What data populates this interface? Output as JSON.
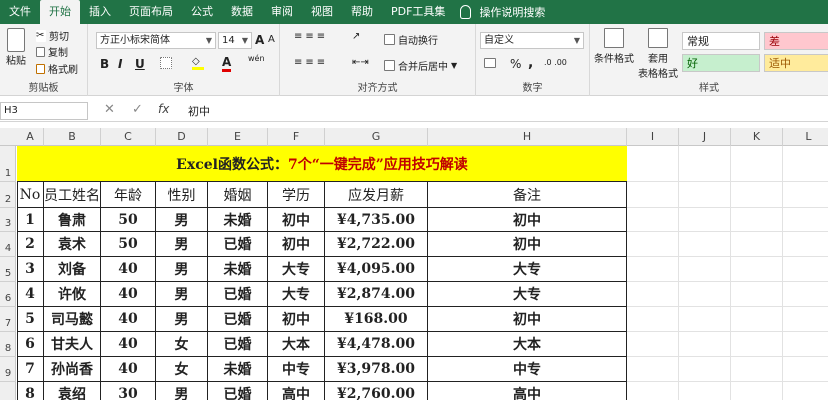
{
  "ribbon_tabs": [
    "文件",
    "开始",
    "插入",
    "页面布局",
    "公式",
    "数据",
    "审阅",
    "视图",
    "帮助",
    "PDF工具集",
    "操作说明搜索"
  ],
  "clipboard": {
    "paste": "粘贴",
    "cut": "剪切",
    "copy": "复制",
    "painter": "格式刷",
    "label": "剪贴板"
  },
  "font": {
    "name": "方正小标宋简体",
    "size": "14",
    "label": "字体",
    "bold": "B",
    "italic": "I",
    "underline": "U",
    "grow": "A",
    "shrink": "A",
    "wen": "wén"
  },
  "alignment": {
    "wrap": "自动换行",
    "merge": "合并后居中",
    "label": "对齐方式"
  },
  "number": {
    "format": "自定义",
    "pct": "%",
    "comma": ",",
    "label": "数字"
  },
  "styles": {
    "cond": "条件格式",
    "table": "套用\n表格格式",
    "normal": "常规",
    "bad": "差",
    "good": "好",
    "neutral": "适中",
    "label": "样式"
  },
  "formula_bar": {
    "name_box": "H3",
    "cancel": "✕",
    "enter": "✓",
    "fx": "fx",
    "content": "初中"
  },
  "columns": [
    "A",
    "B",
    "C",
    "D",
    "E",
    "F",
    "G",
    "H",
    "I",
    "J",
    "K",
    "L"
  ],
  "rows": [
    "1",
    "2",
    "3",
    "4",
    "5",
    "6",
    "7",
    "8",
    "9"
  ],
  "title": {
    "prefix": "Excel函数公式：",
    "suffix": "7个“一键完成”应用技巧解读"
  },
  "headers": [
    "No",
    "员工姓名",
    "年龄",
    "性别",
    "婚姻",
    "学历",
    "应发月薪",
    "备注"
  ],
  "table_rows": [
    [
      "1",
      "鲁肃",
      "50",
      "男",
      "未婚",
      "初中",
      "¥4,735.00",
      "初中"
    ],
    [
      "2",
      "袁术",
      "50",
      "男",
      "已婚",
      "初中",
      "¥2,722.00",
      "初中"
    ],
    [
      "3",
      "刘备",
      "40",
      "男",
      "未婚",
      "大专",
      "¥4,095.00",
      "大专"
    ],
    [
      "4",
      "许攸",
      "40",
      "男",
      "已婚",
      "大专",
      "¥2,874.00",
      "大专"
    ],
    [
      "5",
      "司马懿",
      "40",
      "男",
      "已婚",
      "初中",
      "¥168.00",
      "初中"
    ],
    [
      "6",
      "甘夫人",
      "40",
      "女",
      "已婚",
      "大本",
      "¥4,478.00",
      "大本"
    ],
    [
      "7",
      "孙尚香",
      "40",
      "女",
      "未婚",
      "中专",
      "¥3,978.00",
      "中专"
    ],
    [
      "8",
      "袁绍",
      "30",
      "男",
      "已婚",
      "高中",
      "¥2,760.00",
      "高中"
    ]
  ],
  "colors": {
    "ribbon": "#217346",
    "title_fill": "#ffff00",
    "title_red": "#c00000"
  }
}
